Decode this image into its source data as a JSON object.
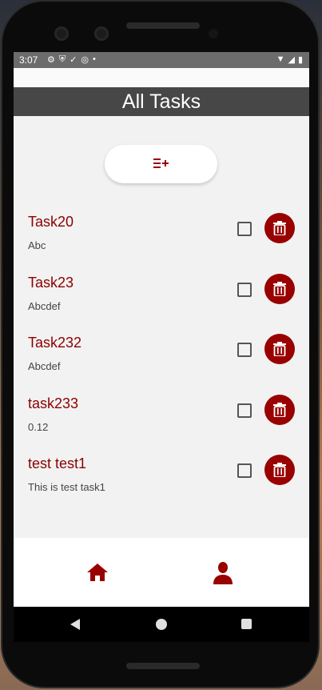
{
  "status_bar": {
    "time": "3:07",
    "left_icons": [
      "gear-icon",
      "shield-icon",
      "check-download-icon",
      "cast-off-icon",
      "dot-icon"
    ],
    "right_icons": [
      "wifi-icon",
      "signal-icon",
      "battery-icon"
    ]
  },
  "header": {
    "title": "All Tasks"
  },
  "add_button": {
    "icon": "add-list-icon"
  },
  "tasks": [
    {
      "name": "Task20",
      "description": "Abc"
    },
    {
      "name": "Task23",
      "description": "Abcdef"
    },
    {
      "name": "Task232",
      "description": "Abcdef"
    },
    {
      "name": "task233",
      "description": "0.12"
    },
    {
      "name": "test test1",
      "description": "This is test task1"
    }
  ],
  "bottom_nav": {
    "items": [
      "home-icon",
      "profile-icon"
    ]
  },
  "colors": {
    "accent": "#990000",
    "task_text": "#8b0000",
    "header_bg": "#474747",
    "screen_bg": "#f2f2f2"
  }
}
